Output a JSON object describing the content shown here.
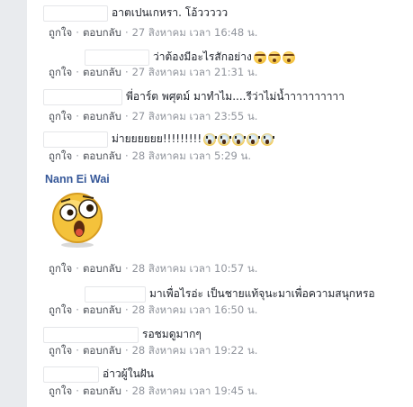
{
  "comments": [
    {
      "text": "อาตเปนเกหรา. โอ้ววววว",
      "like": "ถูกใจ",
      "reply": "ตอบกลับ",
      "time": "27 สิงหาคม เวลา 16:48 น."
    },
    {
      "text": "ว่าต้องมีอะไรสักอย่าง",
      "emoji": [
        "thinking-face",
        "thinking-face",
        "thinking-face"
      ],
      "like": "ถูกใจ",
      "reply": "ตอบกลับ",
      "time": "27 สิงหาคม เวลา 21:31 น."
    },
    {
      "text": "พี่อาร์ต พศุตม์ มาทำไม....รีว่าไม่น้ำาาาาาาาาา",
      "like": "ถูกใจ",
      "reply": "ตอบกลับ",
      "time": "27 สิงหาคม เวลา 23:55 น."
    },
    {
      "text": "ม่ายยยยยย!!!!!!!!!",
      "emoji": [
        "screaming-face",
        "screaming-face",
        "screaming-face",
        "screaming-face",
        "screaming-face"
      ],
      "like": "ถูกใจ",
      "reply": "ตอบกลับ",
      "time": "28 สิงหาคม เวลา 5:29 น."
    },
    {
      "author": "Nann Ei Wai",
      "sticker": "surprised-emoji-sticker",
      "like": "ถูกใจ",
      "reply": "ตอบกลับ",
      "time": "28 สิงหาคม เวลา 10:57 น."
    },
    {
      "text": "มาเพื่อไรอ่ะ เป็นชายแท้จุนะมาเพื่อความสนุกหรอ",
      "like": "ถูกใจ",
      "reply": "ตอบกลับ",
      "time": "28 สิงหาคม เวลา 16:50 น."
    },
    {
      "text": "รอชมดูมากๆ",
      "like": "ถูกใจ",
      "reply": "ตอบกลับ",
      "time": "28 สิงหาคม เวลา 19:22 น."
    },
    {
      "text": "อ่าวผู้ในฝัน",
      "like": "ถูกใจ",
      "reply": "ตอบกลับ",
      "time": "28 สิงหาคม เวลา 19:45 น."
    }
  ],
  "separator": "·"
}
